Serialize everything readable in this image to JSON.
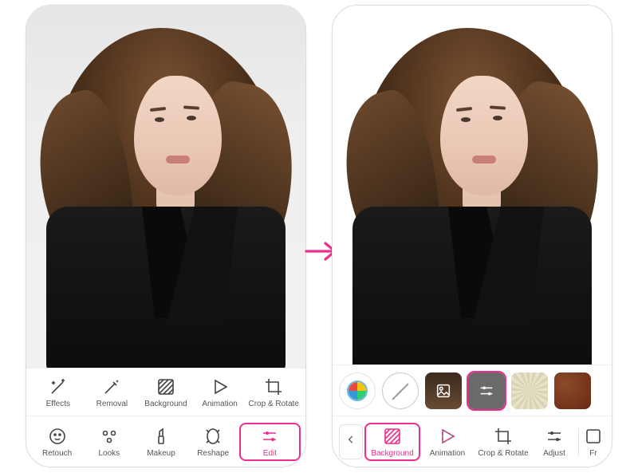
{
  "accent_color": "#ec2f8c",
  "left": {
    "upper_tools": [
      {
        "id": "effects",
        "label": "Effects",
        "icon": "sparkle-wand"
      },
      {
        "id": "removal",
        "label": "Removal",
        "icon": "eraser-wand"
      },
      {
        "id": "background",
        "label": "Background",
        "icon": "hatch-square"
      },
      {
        "id": "animation",
        "label": "Animation",
        "icon": "play-triangle"
      },
      {
        "id": "crop",
        "label": "Crop & Rotate",
        "icon": "crop"
      }
    ],
    "lower_tools": [
      {
        "id": "retouch",
        "label": "Retouch",
        "icon": "face",
        "selected": false
      },
      {
        "id": "looks",
        "label": "Looks",
        "icon": "dots",
        "selected": false
      },
      {
        "id": "makeup",
        "label": "Makeup",
        "icon": "lipstick",
        "selected": false
      },
      {
        "id": "reshape",
        "label": "Reshape",
        "icon": "reshape",
        "selected": false
      },
      {
        "id": "edit",
        "label": "Edit",
        "icon": "sliders",
        "selected": true
      }
    ]
  },
  "right": {
    "bg_thumbs": [
      {
        "id": "store",
        "kind": "store"
      },
      {
        "id": "none",
        "kind": "none"
      },
      {
        "id": "orig",
        "kind": "photo"
      },
      {
        "id": "adjust",
        "kind": "sliders",
        "selected": true
      },
      {
        "id": "tex1",
        "kind": "pattern1"
      },
      {
        "id": "tex2",
        "kind": "pattern2"
      }
    ],
    "lower_tools": [
      {
        "id": "background",
        "label": "Background",
        "icon": "hatch-square",
        "selected": true
      },
      {
        "id": "animation",
        "label": "Animation",
        "icon": "play-color"
      },
      {
        "id": "crop",
        "label": "Crop & Rotate",
        "icon": "crop"
      },
      {
        "id": "adjust",
        "label": "Adjust",
        "icon": "sliders"
      },
      {
        "id": "fr",
        "label": "Fr",
        "icon": "frame",
        "partial": true
      }
    ],
    "back_label": "‹"
  }
}
